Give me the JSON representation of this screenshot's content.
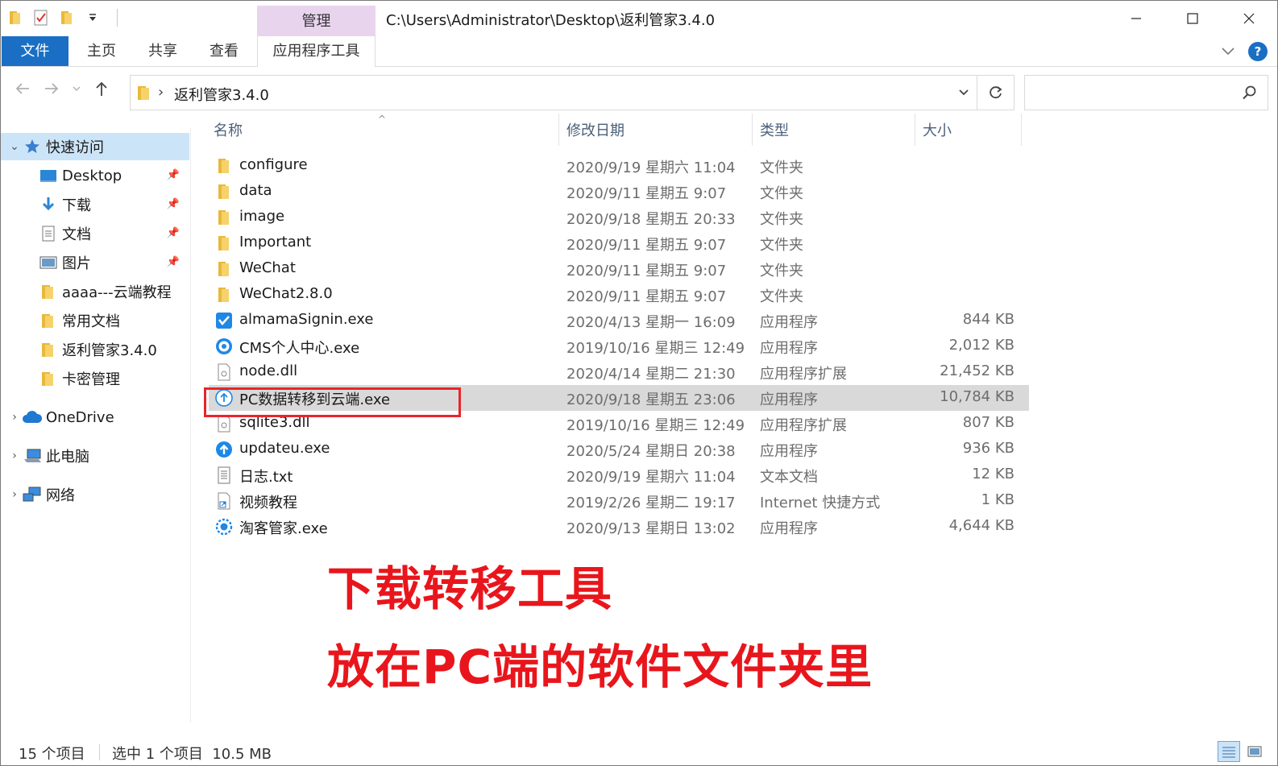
{
  "window": {
    "title": "C:\\Users\\Administrator\\Desktop\\返利管家3.4.0",
    "context_tab_group": "管理"
  },
  "ribbon": {
    "tabs": [
      {
        "label": "文件"
      },
      {
        "label": "主页"
      },
      {
        "label": "共享"
      },
      {
        "label": "查看"
      },
      {
        "label": "应用程序工具"
      }
    ]
  },
  "address": {
    "crumb": "返利管家3.4.0"
  },
  "search": {
    "placeholder": ""
  },
  "sidebar": {
    "items": [
      {
        "label": "快速访问",
        "icon": "star-icon"
      },
      {
        "label": "Desktop",
        "icon": "desktop-icon"
      },
      {
        "label": "下载",
        "icon": "download-icon"
      },
      {
        "label": "文档",
        "icon": "document-icon"
      },
      {
        "label": "图片",
        "icon": "picture-icon"
      },
      {
        "label": "aaaa---云端教程",
        "icon": "folder-icon"
      },
      {
        "label": "常用文档",
        "icon": "folder-icon"
      },
      {
        "label": "返利管家3.4.0",
        "icon": "folder-icon"
      },
      {
        "label": "卡密管理",
        "icon": "folder-icon"
      },
      {
        "label": "OneDrive",
        "icon": "cloud-icon"
      },
      {
        "label": "此电脑",
        "icon": "computer-icon"
      },
      {
        "label": "网络",
        "icon": "network-icon"
      }
    ]
  },
  "columns": {
    "name": "名称",
    "date": "修改日期",
    "type": "类型",
    "size": "大小"
  },
  "files": [
    {
      "name": "configure",
      "date": "2020/9/19 星期六 11:04",
      "type": "文件夹",
      "size": "",
      "icon": "folder-icon"
    },
    {
      "name": "data",
      "date": "2020/9/11 星期五 9:07",
      "type": "文件夹",
      "size": "",
      "icon": "folder-icon"
    },
    {
      "name": "image",
      "date": "2020/9/18 星期五 20:33",
      "type": "文件夹",
      "size": "",
      "icon": "folder-icon"
    },
    {
      "name": "Important",
      "date": "2020/9/11 星期五 9:07",
      "type": "文件夹",
      "size": "",
      "icon": "folder-icon"
    },
    {
      "name": "WeChat",
      "date": "2020/9/11 星期五 9:07",
      "type": "文件夹",
      "size": "",
      "icon": "folder-icon"
    },
    {
      "name": "WeChat2.8.0",
      "date": "2020/9/11 星期五 9:07",
      "type": "文件夹",
      "size": "",
      "icon": "folder-icon"
    },
    {
      "name": "almamaSignin.exe",
      "date": "2020/4/13 星期一 16:09",
      "type": "应用程序",
      "size": "844 KB",
      "icon": "app-check-icon"
    },
    {
      "name": "CMS个人中心.exe",
      "date": "2019/10/16 星期三 12:49",
      "type": "应用程序",
      "size": "2,012 KB",
      "icon": "app-speed-icon"
    },
    {
      "name": "node.dll",
      "date": "2020/4/14 星期二 21:30",
      "type": "应用程序扩展",
      "size": "21,452 KB",
      "icon": "dll-icon"
    },
    {
      "name": "PC数据转移到云端.exe",
      "date": "2020/9/18 星期五 23:06",
      "type": "应用程序",
      "size": "10,784 KB",
      "icon": "upload-icon",
      "selected": true
    },
    {
      "name": "sqlite3.dll",
      "date": "2019/10/16 星期三 12:49",
      "type": "应用程序扩展",
      "size": "807 KB",
      "icon": "dll-icon"
    },
    {
      "name": "updateu.exe",
      "date": "2020/5/24 星期日 20:38",
      "type": "应用程序",
      "size": "936 KB",
      "icon": "update-icon"
    },
    {
      "name": "日志.txt",
      "date": "2020/9/19 星期六 11:04",
      "type": "文本文档",
      "size": "12 KB",
      "icon": "text-file-icon"
    },
    {
      "name": "视频教程",
      "date": "2019/2/26 星期二 19:17",
      "type": "Internet 快捷方式",
      "size": "1 KB",
      "icon": "shortcut-icon"
    },
    {
      "name": "淘客管家.exe",
      "date": "2020/9/13 星期日 13:02",
      "type": "应用程序",
      "size": "4,644 KB",
      "icon": "app-gear-icon"
    }
  ],
  "overlay": {
    "line1": "下载转移工具",
    "line2": "放在PC端的软件文件夹里"
  },
  "status": {
    "count": "15 个项目",
    "selection": "选中 1 个项目  10.5 MB"
  },
  "colors": {
    "accent": "#1a6fc4",
    "context_tab": "#e9d4ee",
    "selection": "#cce4f7",
    "annotation_red": "#e8161c"
  }
}
